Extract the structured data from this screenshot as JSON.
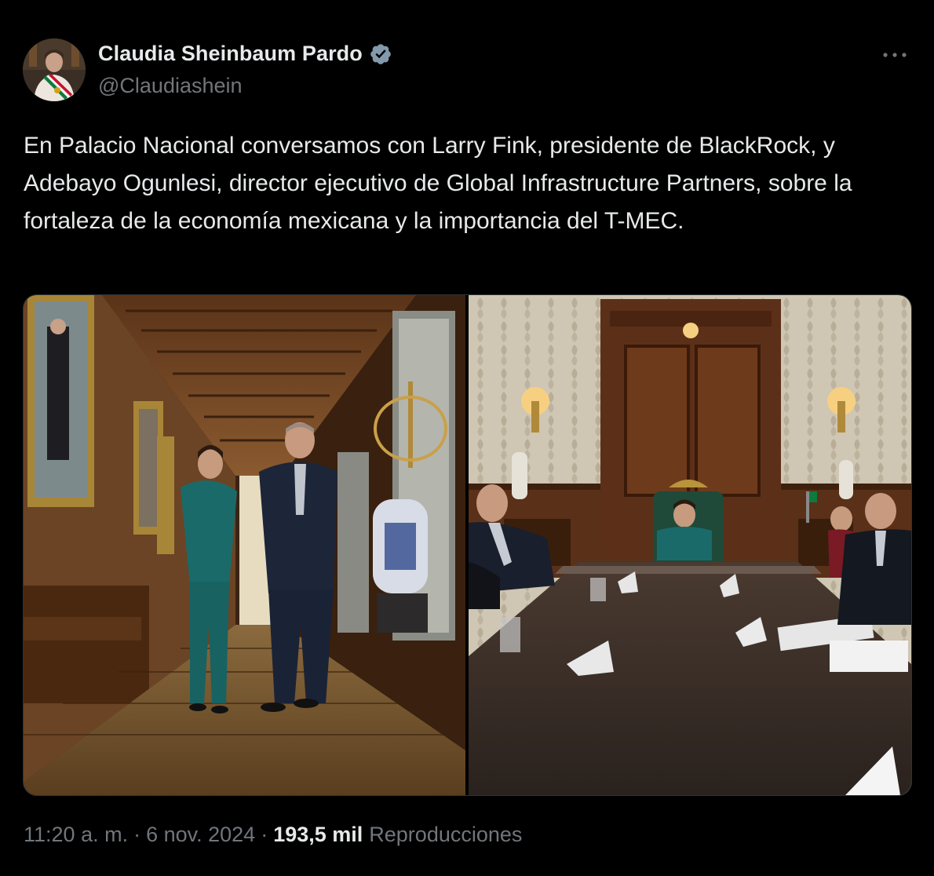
{
  "author": {
    "display_name": "Claudia Sheinbaum Pardo",
    "handle": "@Claudiashein",
    "verified": true,
    "verified_color": "#829aab"
  },
  "more_icon": "more-horizontal-icon",
  "tweet": {
    "text": "En Palacio Nacional conversamos con Larry Fink, presidente de BlackRock, y Adebayo Ogunlesi, director ejecutivo de Global Infrastructure Partners, sobre la fortaleza de la economía mexicana y la importancia del T-MEC."
  },
  "media": {
    "photos": [
      {
        "name": "hallway-photo"
      },
      {
        "name": "meeting-room-photo"
      }
    ]
  },
  "meta": {
    "time": "11:20 a. m.",
    "separator": "·",
    "date": "6 nov. 2024",
    "views_count": "193,5 mil",
    "views_label": "Reproducciones"
  },
  "colors": {
    "background": "#000000",
    "text_primary": "#e7e9ea",
    "text_secondary": "#71767b",
    "border": "#2f3336"
  }
}
